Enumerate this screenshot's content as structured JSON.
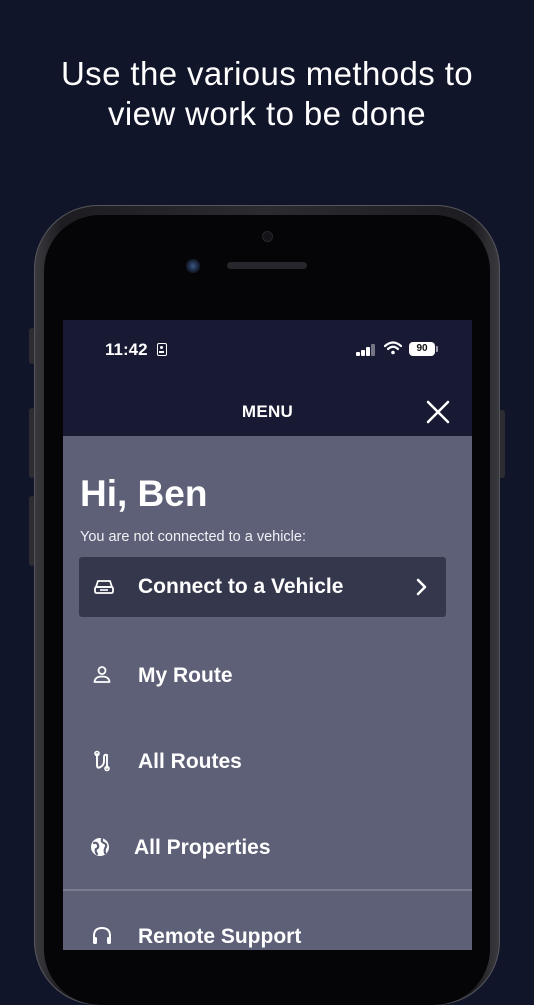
{
  "headline": {
    "line1": "Use the various methods to",
    "line2": "view work to be done"
  },
  "status_bar": {
    "time": "11:42",
    "battery_level": "90",
    "icons": [
      "id-card-icon",
      "signal-icon",
      "wifi-icon",
      "battery-icon"
    ]
  },
  "header": {
    "title": "MENU",
    "close_icon": "close-icon"
  },
  "greeting": "Hi, Ben",
  "connection_note": "You are not connected to a vehicle:",
  "connect_card": {
    "label": "Connect to a Vehicle",
    "icon": "car-icon",
    "chevron": "chevron-right-icon"
  },
  "menu_items": [
    {
      "label": "My Route",
      "icon": "person-icon"
    },
    {
      "label": "All Routes",
      "icon": "route-icon"
    },
    {
      "label": "All Properties",
      "icon": "globe-icon"
    },
    {
      "label": "Remote Support",
      "icon": "headset-icon"
    }
  ],
  "colors": {
    "page_background": "#11152a",
    "menu_bar": "#181a33",
    "menu_background": "#5d6077",
    "card_background": "#35384d",
    "text": "#ffffff"
  }
}
